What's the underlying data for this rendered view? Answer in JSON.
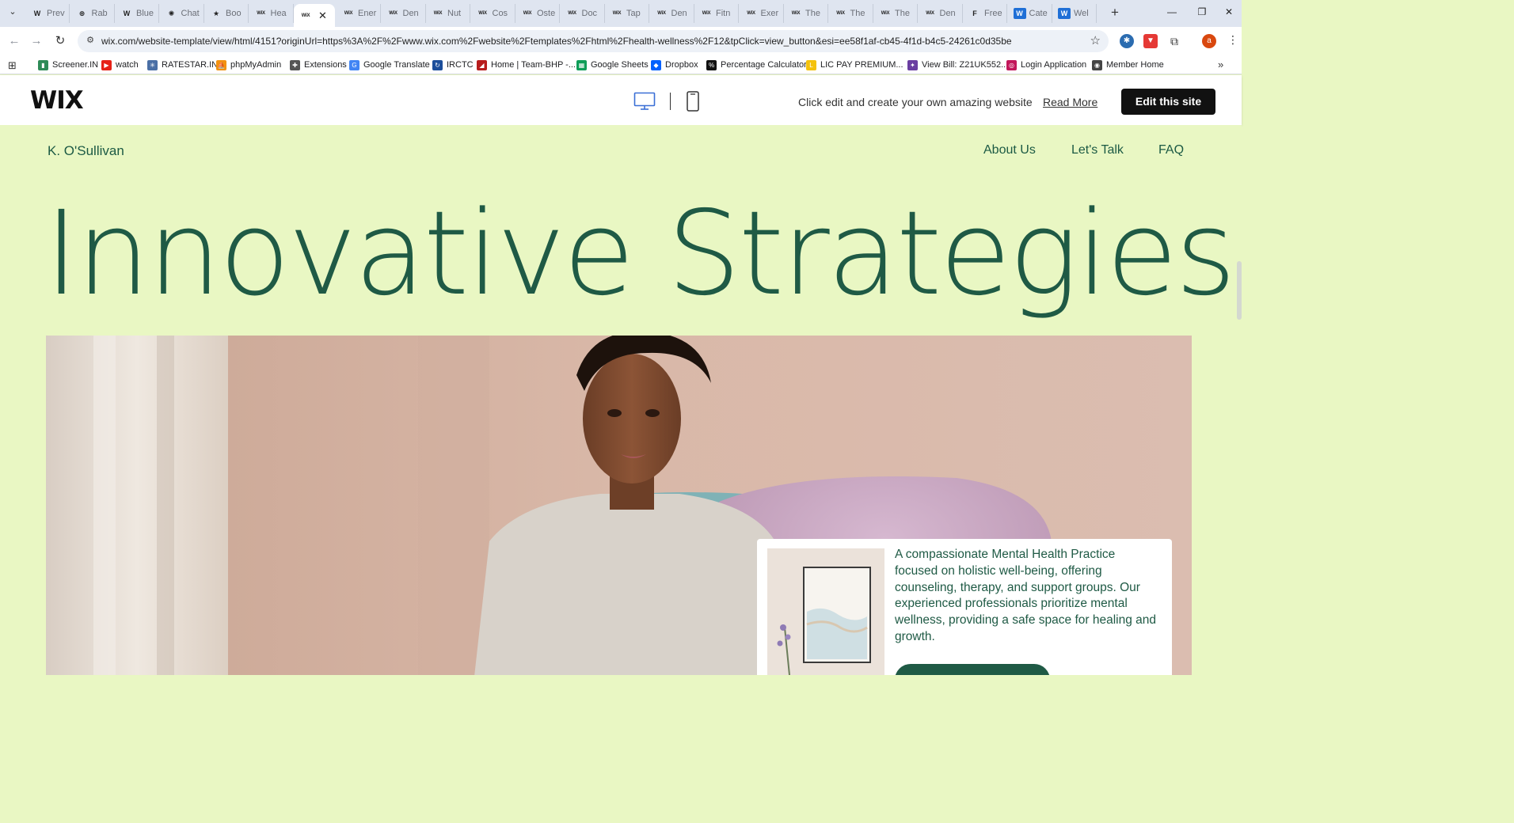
{
  "browser": {
    "tabs": [
      {
        "icon": "W",
        "label": "Prev"
      },
      {
        "icon": "⊕",
        "label": "Rab"
      },
      {
        "icon": "W",
        "label": "Blue"
      },
      {
        "icon": "✺",
        "label": "Chat"
      },
      {
        "icon": "★",
        "label": "Boo"
      },
      {
        "icon": "WiX",
        "label": "Hea"
      },
      {
        "icon": "WiX",
        "label": "",
        "active": true
      },
      {
        "icon": "WiX",
        "label": "Ener"
      },
      {
        "icon": "WiX",
        "label": "Den"
      },
      {
        "icon": "WiX",
        "label": "Nut"
      },
      {
        "icon": "WiX",
        "label": "Cos"
      },
      {
        "icon": "WiX",
        "label": "Oste"
      },
      {
        "icon": "WiX",
        "label": "Doc"
      },
      {
        "icon": "WiX",
        "label": "Tap"
      },
      {
        "icon": "WiX",
        "label": "Den"
      },
      {
        "icon": "WiX",
        "label": "Fitn"
      },
      {
        "icon": "WiX",
        "label": "Exer"
      },
      {
        "icon": "WiX",
        "label": "The"
      },
      {
        "icon": "WiX",
        "label": "The"
      },
      {
        "icon": "WiX",
        "label": "The"
      },
      {
        "icon": "WiX",
        "label": "Den"
      },
      {
        "icon": "F",
        "label": "Free"
      },
      {
        "icon": "W",
        "label": "Cate"
      },
      {
        "icon": "W",
        "label": "Wel"
      }
    ],
    "url": "wix.com/website-template/view/html/4151?originUrl=https%3A%2F%2Fwww.wix.com%2Fwebsite%2Ftemplates%2Fhtml%2Fhealth-wellness%2F12&tpClick=view_button&esi=ee58f1af-cb45-4f1d-b4c5-24261c0d35be",
    "profile_initial": "a",
    "bookmarks": [
      {
        "label": "Screener.IN",
        "color": "#2e8b57",
        "icon": "▮"
      },
      {
        "label": "watch",
        "color": "#e62117",
        "icon": "▶"
      },
      {
        "label": "RATESTAR.IN",
        "color": "#4a6fa5",
        "icon": "✳"
      },
      {
        "label": "phpMyAdmin",
        "color": "#f29111",
        "icon": "⛵"
      },
      {
        "label": "Extensions",
        "color": "#555555",
        "icon": "✚"
      },
      {
        "label": "Google Translate",
        "color": "#4285f4",
        "icon": "G"
      },
      {
        "label": "IRCTC",
        "color": "#1c4e9b",
        "icon": "↻"
      },
      {
        "label": "Home | Team-BHP -...",
        "color": "#b71c1c",
        "icon": "◢"
      },
      {
        "label": "Google Sheets",
        "color": "#0f9d58",
        "icon": "▦"
      },
      {
        "label": "Dropbox",
        "color": "#0061fe",
        "icon": "◆"
      },
      {
        "label": "Percentage Calculator",
        "color": "#111111",
        "icon": "%"
      },
      {
        "label": "LIC PAY PREMIUM...",
        "color": "#f4c20d",
        "icon": "L"
      },
      {
        "label": "View Bill: Z21UK552...",
        "color": "#6a3ea1",
        "icon": "✦"
      },
      {
        "label": "Login Application",
        "color": "#c2185b",
        "icon": "◎"
      },
      {
        "label": "Member Home",
        "color": "#444444",
        "icon": "◉"
      }
    ]
  },
  "wix_bar": {
    "logo": "WIX",
    "promo_text": "Click edit and create your own amazing website",
    "read_more": "Read More",
    "edit_button": "Edit this site"
  },
  "site": {
    "brand": "K. O'Sullivan",
    "nav": [
      "About Us",
      "Let's Talk",
      "FAQ"
    ],
    "hero_title": "Innovative Strategies",
    "card_text": "A compassionate Mental Health Practice focused on holistic well-being, offering counseling, therapy, and support groups. Our experienced professionals prioritize mental wellness, providing a safe space for healing and growth."
  },
  "colors": {
    "site_bg": "#e9f7c3",
    "brand_green": "#1f5a45",
    "tabstrip": "#dfe5f0",
    "edit_button": "#111111"
  }
}
